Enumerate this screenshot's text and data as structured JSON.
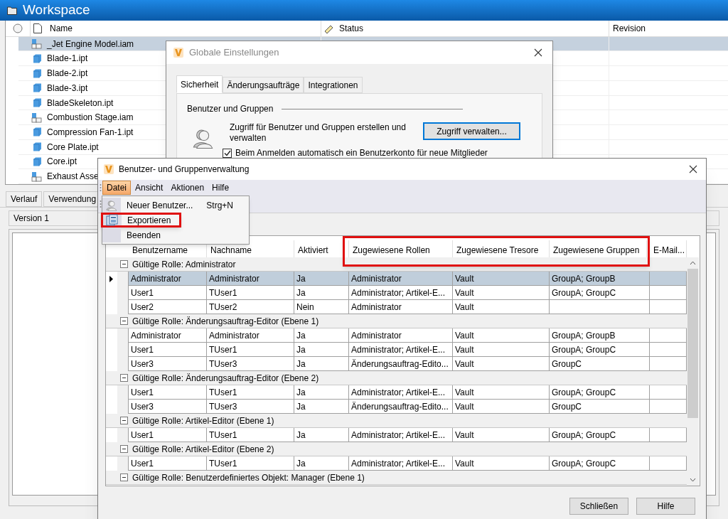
{
  "workspace": {
    "title": "Workspace",
    "columns": [
      "Name",
      "Status",
      "Revision"
    ],
    "files": [
      {
        "name": "_Jet Engine Model.iam",
        "kind": "assembly",
        "selected": true
      },
      {
        "name": "Blade-1.ipt",
        "kind": "part",
        "selected": false
      },
      {
        "name": "Blade-2.ipt",
        "kind": "part",
        "selected": false
      },
      {
        "name": "Blade-3.ipt",
        "kind": "part",
        "selected": false
      },
      {
        "name": "BladeSkeleton.ipt",
        "kind": "part",
        "selected": false
      },
      {
        "name": "Combustion Stage.iam",
        "kind": "assembly",
        "selected": false
      },
      {
        "name": "Compression Fan-1.ipt",
        "kind": "part",
        "selected": false
      },
      {
        "name": "Core Plate.ipt",
        "kind": "part",
        "selected": false
      },
      {
        "name": "Core.ipt",
        "kind": "part",
        "selected": false
      },
      {
        "name": "Exhaust Asse",
        "kind": "assembly",
        "selected": false
      }
    ],
    "bottom_tabs": [
      {
        "label": "Verlauf",
        "selected": false
      },
      {
        "label": "Verwendung",
        "selected": false
      }
    ],
    "version_header": "Version 1"
  },
  "global_settings": {
    "title": "Globale Einstellungen",
    "tabs": [
      {
        "label": "Sicherheit",
        "selected": true
      },
      {
        "label": "Änderungsaufträge",
        "selected": false
      },
      {
        "label": "Integrationen",
        "selected": false
      }
    ],
    "section": "Benutzer und Gruppen",
    "description": "Zugriff für Benutzer und Gruppen erstellen und verwalten",
    "button": "Zugriff verwalten...",
    "checkbox": {
      "label": "Beim Anmelden automatisch ein Benutzerkonto für neue Mitglieder",
      "checked": true
    }
  },
  "user_dialog": {
    "title": "Benutzer- und Gruppenverwaltung",
    "menu": [
      {
        "label": "Datei",
        "selected": true
      },
      {
        "label": "Ansicht",
        "selected": false
      },
      {
        "label": "Aktionen",
        "selected": false
      },
      {
        "label": "Hilfe",
        "selected": false
      }
    ],
    "dropdown": [
      {
        "label": "Neuer Benutzer...",
        "shortcut": "Strg+N",
        "kind": "user",
        "highlighted": false
      },
      {
        "label": "Exportieren",
        "kind": "export",
        "highlighted": true
      },
      {
        "label": "Beenden",
        "kind": "none",
        "highlighted": false
      }
    ],
    "columns": [
      {
        "label": "Benutzername",
        "highlighted": false
      },
      {
        "label": "Nachname",
        "highlighted": false
      },
      {
        "label": "Aktiviert",
        "highlighted": false
      },
      {
        "label": "Zugewiesene Rollen",
        "highlighted": true
      },
      {
        "label": "Zugewiesene Tresore",
        "highlighted": true
      },
      {
        "label": "Zugewiesene Gruppen",
        "highlighted": true
      },
      {
        "label": "E-Mail...",
        "highlighted": false
      }
    ],
    "groups": [
      {
        "title": "Gültige Rolle: Administrator",
        "expanded": true,
        "rows": [
          {
            "cells": [
              "Administrator",
              "Administrator",
              "Ja",
              "Administrator",
              "Vault",
              "GroupA; GroupB"
            ],
            "selected": true
          },
          {
            "cells": [
              "User1",
              "TUser1",
              "Ja",
              "Administrator; Artikel-E...",
              "Vault",
              "GroupA; GroupC"
            ],
            "selected": false
          },
          {
            "cells": [
              "User2",
              "TUser2",
              "Nein",
              "Administrator",
              "Vault"
            ],
            "selected": false
          }
        ]
      },
      {
        "title": "Gültige Rolle: Änderungsauftrag-Editor (Ebene 1)",
        "expanded": true,
        "rows": [
          {
            "cells": [
              "Administrator",
              "Administrator",
              "Ja",
              "Administrator",
              "Vault",
              "GroupA; GroupB"
            ],
            "selected": false
          },
          {
            "cells": [
              "User1",
              "TUser1",
              "Ja",
              "Administrator; Artikel-E...",
              "Vault",
              "GroupA; GroupC"
            ],
            "selected": false
          },
          {
            "cells": [
              "User3",
              "TUser3",
              "Ja",
              "Änderungsauftrag-Edito...",
              "Vault",
              "GroupC"
            ],
            "selected": false
          }
        ]
      },
      {
        "title": "Gültige Rolle: Änderungsauftrag-Editor (Ebene 2)",
        "expanded": true,
        "rows": [
          {
            "cells": [
              "User1",
              "TUser1",
              "Ja",
              "Administrator; Artikel-E...",
              "Vault",
              "GroupA; GroupC"
            ],
            "selected": false
          },
          {
            "cells": [
              "User3",
              "TUser3",
              "Ja",
              "Änderungsauftrag-Edito...",
              "Vault",
              "GroupC"
            ],
            "selected": false
          }
        ]
      },
      {
        "title": "Gültige Rolle: Artikel-Editor (Ebene 1)",
        "expanded": true,
        "rows": [
          {
            "cells": [
              "User1",
              "TUser1",
              "Ja",
              "Administrator; Artikel-E...",
              "Vault",
              "GroupA; GroupC"
            ],
            "selected": false
          }
        ]
      },
      {
        "title": "Gültige Rolle: Artikel-Editor (Ebene 2)",
        "expanded": true,
        "rows": [
          {
            "cells": [
              "User1",
              "TUser1",
              "Ja",
              "Administrator; Artikel-E...",
              "Vault",
              "GroupA; GroupC"
            ],
            "selected": false
          }
        ]
      },
      {
        "title": "Gültige Rolle: Benutzerdefiniertes Objekt: Manager (Ebene 1)",
        "expanded": true
      }
    ],
    "buttons": [
      "Schließen",
      "Hilfe"
    ]
  }
}
